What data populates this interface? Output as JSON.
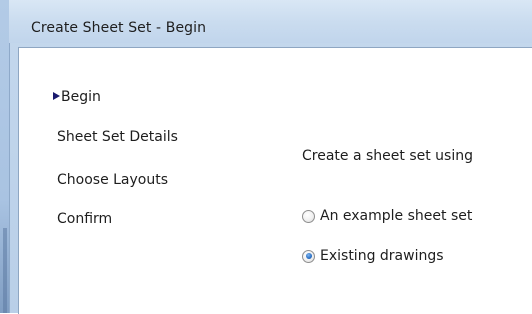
{
  "window": {
    "title": "Create Sheet Set - Begin"
  },
  "nav": {
    "items": [
      {
        "label": "Begin",
        "active": true
      },
      {
        "label": "Sheet Set Details",
        "active": false
      },
      {
        "label": "Choose Layouts",
        "active": false
      },
      {
        "label": "Confirm",
        "active": false
      }
    ],
    "active_indicator_icon": "arrow-right-icon"
  },
  "content": {
    "section_label": "Create a sheet set using",
    "options": [
      {
        "label": "An example sheet set",
        "checked": false
      },
      {
        "label": "Existing drawings",
        "checked": true
      }
    ]
  },
  "colors": {
    "title_bar": "#c1d5ec",
    "client_background": "#ffffff",
    "radio_selected": "#2a6fc4",
    "active_arrow": "#1a1a6e"
  }
}
